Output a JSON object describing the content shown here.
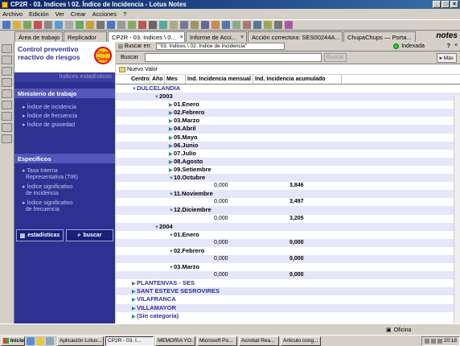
{
  "window": {
    "title": "CP2R - 03. Indices \\ 02. Índice de Incidencia - Lotus Notes"
  },
  "menu": [
    "Archivo",
    "Edición",
    "Ver",
    "Crear",
    "Acciones",
    "?"
  ],
  "tabs": [
    {
      "label": "Área de trabajo"
    },
    {
      "label": "Replicador"
    },
    {
      "label": "CP2R - 03. Indices \\ 0..."
    },
    {
      "label": "Informe de Acci..."
    },
    {
      "label": "Acción correctora: SES00244A..."
    },
    {
      "label": "ChupaChups — Porta..."
    }
  ],
  "brand": "notes",
  "nav": {
    "title_line1": "Control preventivo",
    "title_line2": "reactivo de riesgos",
    "logo_text": "Chupa Chups",
    "subtitle": "Índices estadísticos",
    "section1": "Ministerio de trabajo",
    "section1_items": [
      "Índice de incidencia",
      "Índice de frecuencia",
      "Índice de gravedad"
    ],
    "section2": "Específicos",
    "section2_items": [
      [
        "Tasa Interna",
        "Representativa (TIR)"
      ],
      [
        "Índice significativo",
        "de incidencia"
      ],
      [
        "Índice significativo",
        "de frecuencia"
      ]
    ],
    "btn_stats": "estadísticas",
    "btn_search": "buscar"
  },
  "search": {
    "search_in_label": "Buscar en:",
    "path": "\"03. Indices \\ 02. Índice de Incidencia\"",
    "indexed": "Indexada",
    "label": "Buscar",
    "button": "Buscar",
    "more": "Más"
  },
  "action": {
    "new_value": "Nuevo Valor"
  },
  "columns": [
    "Centro",
    "Año",
    "Mes",
    "Ind. Incidencia mensual",
    "Ind. Incidencia acumulado"
  ],
  "rows": [
    {
      "level": 0,
      "text": "DULCELANDIA",
      "open": true
    },
    {
      "level": 1,
      "text": "2003",
      "open": true
    },
    {
      "level": 2,
      "text": "01.Enero"
    },
    {
      "level": 2,
      "text": "02.Febrero"
    },
    {
      "level": 2,
      "text": "03.Marzo"
    },
    {
      "level": 2,
      "text": "04.Abril"
    },
    {
      "level": 2,
      "text": "05.Mayo"
    },
    {
      "level": 2,
      "text": "06.Junio"
    },
    {
      "level": 2,
      "text": "07.Julio"
    },
    {
      "level": 2,
      "text": "08.Agosto"
    },
    {
      "level": 2,
      "text": "09.Setiembre"
    },
    {
      "level": 2,
      "text": "10.Octubre",
      "open": true
    },
    {
      "level": 3,
      "m": "0,000",
      "a": "3,846"
    },
    {
      "level": 2,
      "text": "11.Noviembre",
      "open": true
    },
    {
      "level": 3,
      "m": "0,000",
      "a": "3,497"
    },
    {
      "level": 2,
      "text": "12.Diciembre",
      "open": true
    },
    {
      "level": 3,
      "m": "0,000",
      "a": "3,205"
    },
    {
      "level": 1,
      "text": "2004",
      "open": true
    },
    {
      "level": 2,
      "text": "01.Enero",
      "open": true
    },
    {
      "level": 3,
      "m": "0,000",
      "a": "0,000"
    },
    {
      "level": 2,
      "text": "02.Febrero",
      "open": true
    },
    {
      "level": 3,
      "m": "0,000",
      "a": "0,000"
    },
    {
      "level": 2,
      "text": "03.Marzo",
      "open": true
    },
    {
      "level": 3,
      "m": "0,000",
      "a": "0,000"
    },
    {
      "level": 0,
      "text": "PLANTENVAS - SES"
    },
    {
      "level": 0,
      "text": "SANT ESTEVE SESROVIRES"
    },
    {
      "level": 0,
      "text": "VILAFRANCA"
    },
    {
      "level": 0,
      "text": "VILLAMAYOR"
    },
    {
      "level": 0,
      "text": "(Sin categoría)"
    }
  ],
  "status": {
    "office": "Oficina"
  },
  "taskbar": {
    "start": "Inicio",
    "tasks": [
      "Aplicación Lotus...",
      "CP2R - 03. I...",
      "MEMORIA YO...",
      "Microsoft Po...",
      "Acrobat Rea...",
      "Artículo cong..."
    ],
    "clock": "20:18"
  }
}
